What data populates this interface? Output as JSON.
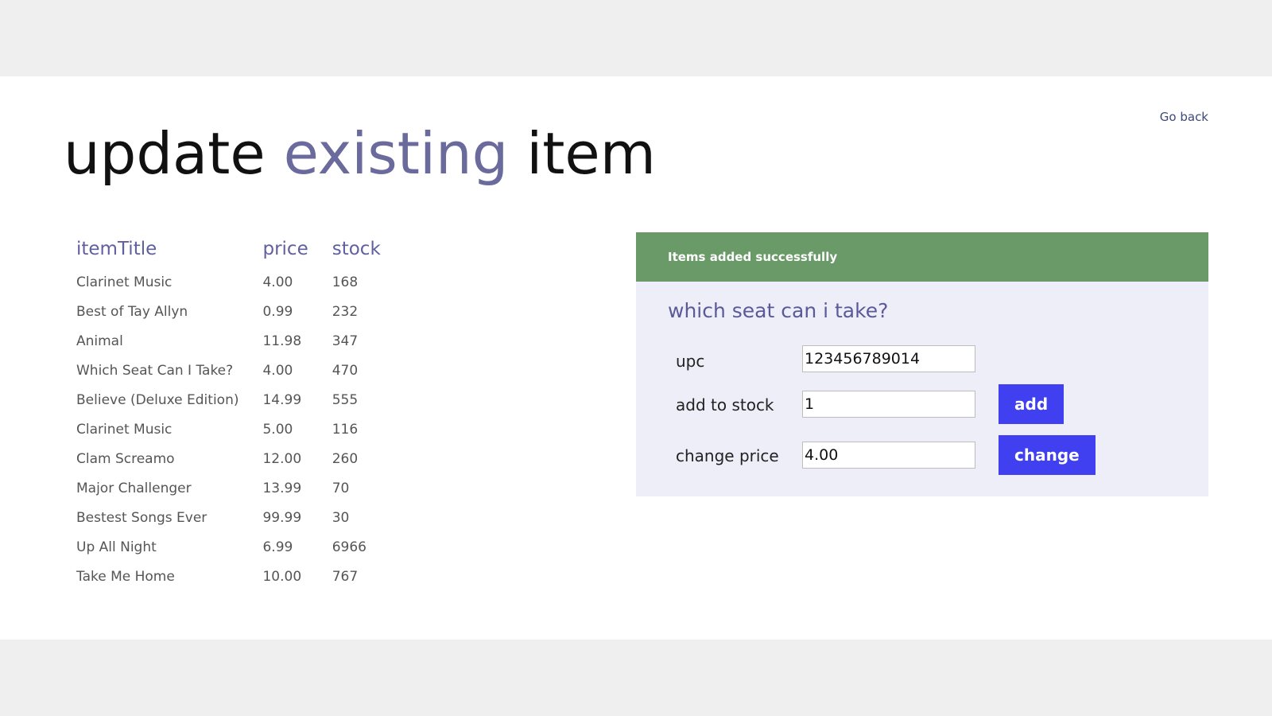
{
  "header": {
    "go_back": "Go back",
    "title_part1": "update ",
    "title_part2": "existing",
    "title_part3": " item"
  },
  "table": {
    "columns": [
      "itemTitle",
      "price",
      "stock"
    ],
    "rows": [
      {
        "title": "Clarinet Music",
        "price": "4.00",
        "stock": "168"
      },
      {
        "title": "Best of Tay Allyn",
        "price": "0.99",
        "stock": "232"
      },
      {
        "title": "Animal",
        "price": "11.98",
        "stock": "347"
      },
      {
        "title": "Which Seat Can I Take?",
        "price": "4.00",
        "stock": "470"
      },
      {
        "title": "Believe (Deluxe Edition)",
        "price": "14.99",
        "stock": "555"
      },
      {
        "title": "Clarinet Music",
        "price": "5.00",
        "stock": "116"
      },
      {
        "title": "Clam Screamo",
        "price": "12.00",
        "stock": "260"
      },
      {
        "title": "Major Challenger",
        "price": "13.99",
        "stock": "70"
      },
      {
        "title": "Bestest Songs Ever",
        "price": "99.99",
        "stock": "30"
      },
      {
        "title": "Up All Night",
        "price": "6.99",
        "stock": "6966"
      },
      {
        "title": "Take Me Home",
        "price": "10.00",
        "stock": "767"
      }
    ]
  },
  "panel": {
    "success_message": "Items added successfully",
    "item_title": "which seat can i take?",
    "upc": {
      "label": "upc",
      "value": "123456789014"
    },
    "add_stock": {
      "label": "add to stock",
      "value": "1",
      "button": "add"
    },
    "change_price": {
      "label": "change price",
      "value": "4.00",
      "button": "change"
    }
  },
  "colors": {
    "accent_text": "#6a6a9d",
    "success_bg": "#6a9a68",
    "panel_bg": "#eeeef8",
    "button_bg": "#4040f0"
  }
}
